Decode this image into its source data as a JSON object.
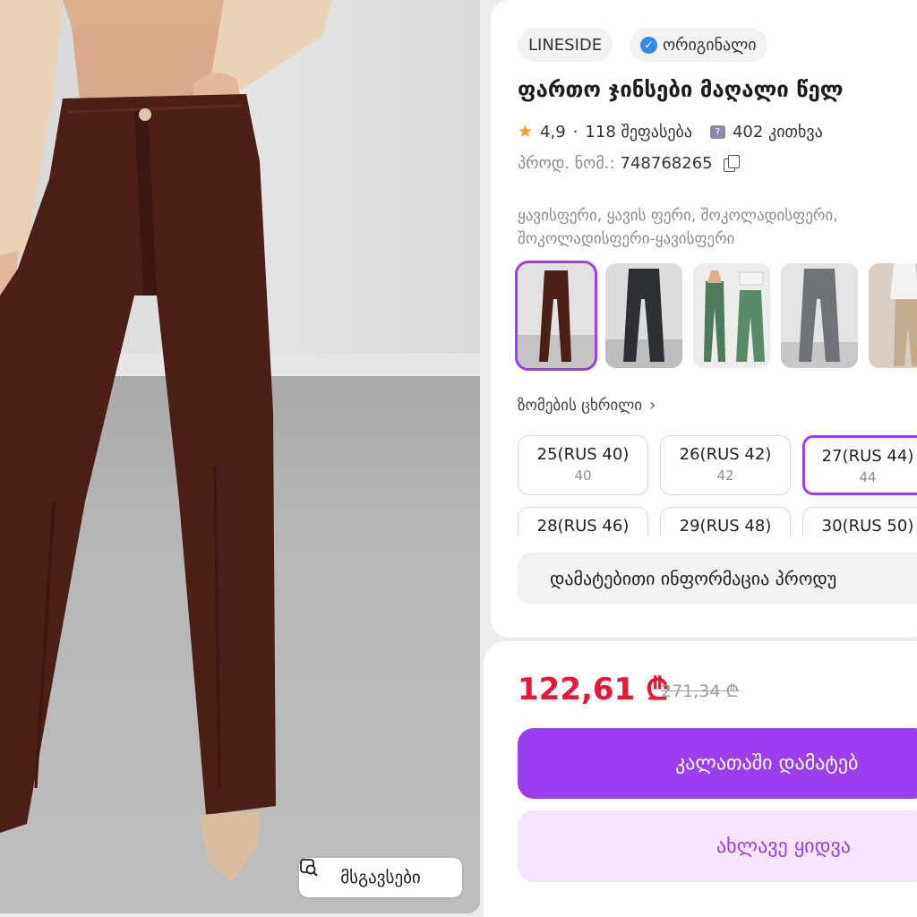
{
  "gallery": {
    "similar_label": "მსგავსები"
  },
  "product": {
    "brand": "LINESIDE",
    "original_label": "ორიგინალი",
    "title": "ფართო ჯინსები მაღალი წელ",
    "rating": "4,9",
    "separator": "·",
    "reviews": "118 შეფასება",
    "questions": "402 კითხვა",
    "sku_label": "პროდ. ნომ.:",
    "sku_value": "748768265",
    "colors_text": "ყავისფერი, ყავის ფერი, შოკოლადისფერი, შოკოლადისფერი-ყავისფერი"
  },
  "variants": [
    {
      "icon": "brown-jeans-thumbnail",
      "selected": true
    },
    {
      "icon": "black-jeans-thumbnail",
      "selected": false
    },
    {
      "icon": "green-jeans-thumbnail",
      "selected": false
    },
    {
      "icon": "gray-jeans-thumbnail",
      "selected": false
    },
    {
      "icon": "beige-jeans-thumbnail",
      "selected": false
    }
  ],
  "size_table_label": "ზომების ცხრილი",
  "sizes": [
    {
      "label": "25(RUS 40)",
      "sub": "40",
      "selected": false
    },
    {
      "label": "26(RUS 42)",
      "sub": "42",
      "selected": false
    },
    {
      "label": "27(RUS 44)",
      "sub": "44",
      "selected": true
    },
    {
      "label": "28(RUS 46)",
      "sub": "",
      "selected": false
    },
    {
      "label": "29(RUS 48)",
      "sub": "",
      "selected": false
    },
    {
      "label": "30(RUS 50)",
      "sub": "",
      "selected": false
    }
  ],
  "more_info_label": "დამატებითი ინფორმაცია პროდუ",
  "pricing": {
    "price": "122,61 ₾",
    "old_price": "271,34 ₾"
  },
  "actions": {
    "add_to_cart": "კალათაში დამატებ",
    "buy_now": "ახლავე ყიდვა"
  },
  "colors": {
    "accent": "#9b3ef0",
    "price_red": "#e8173a",
    "buy_bg": "#f5e4fd"
  }
}
